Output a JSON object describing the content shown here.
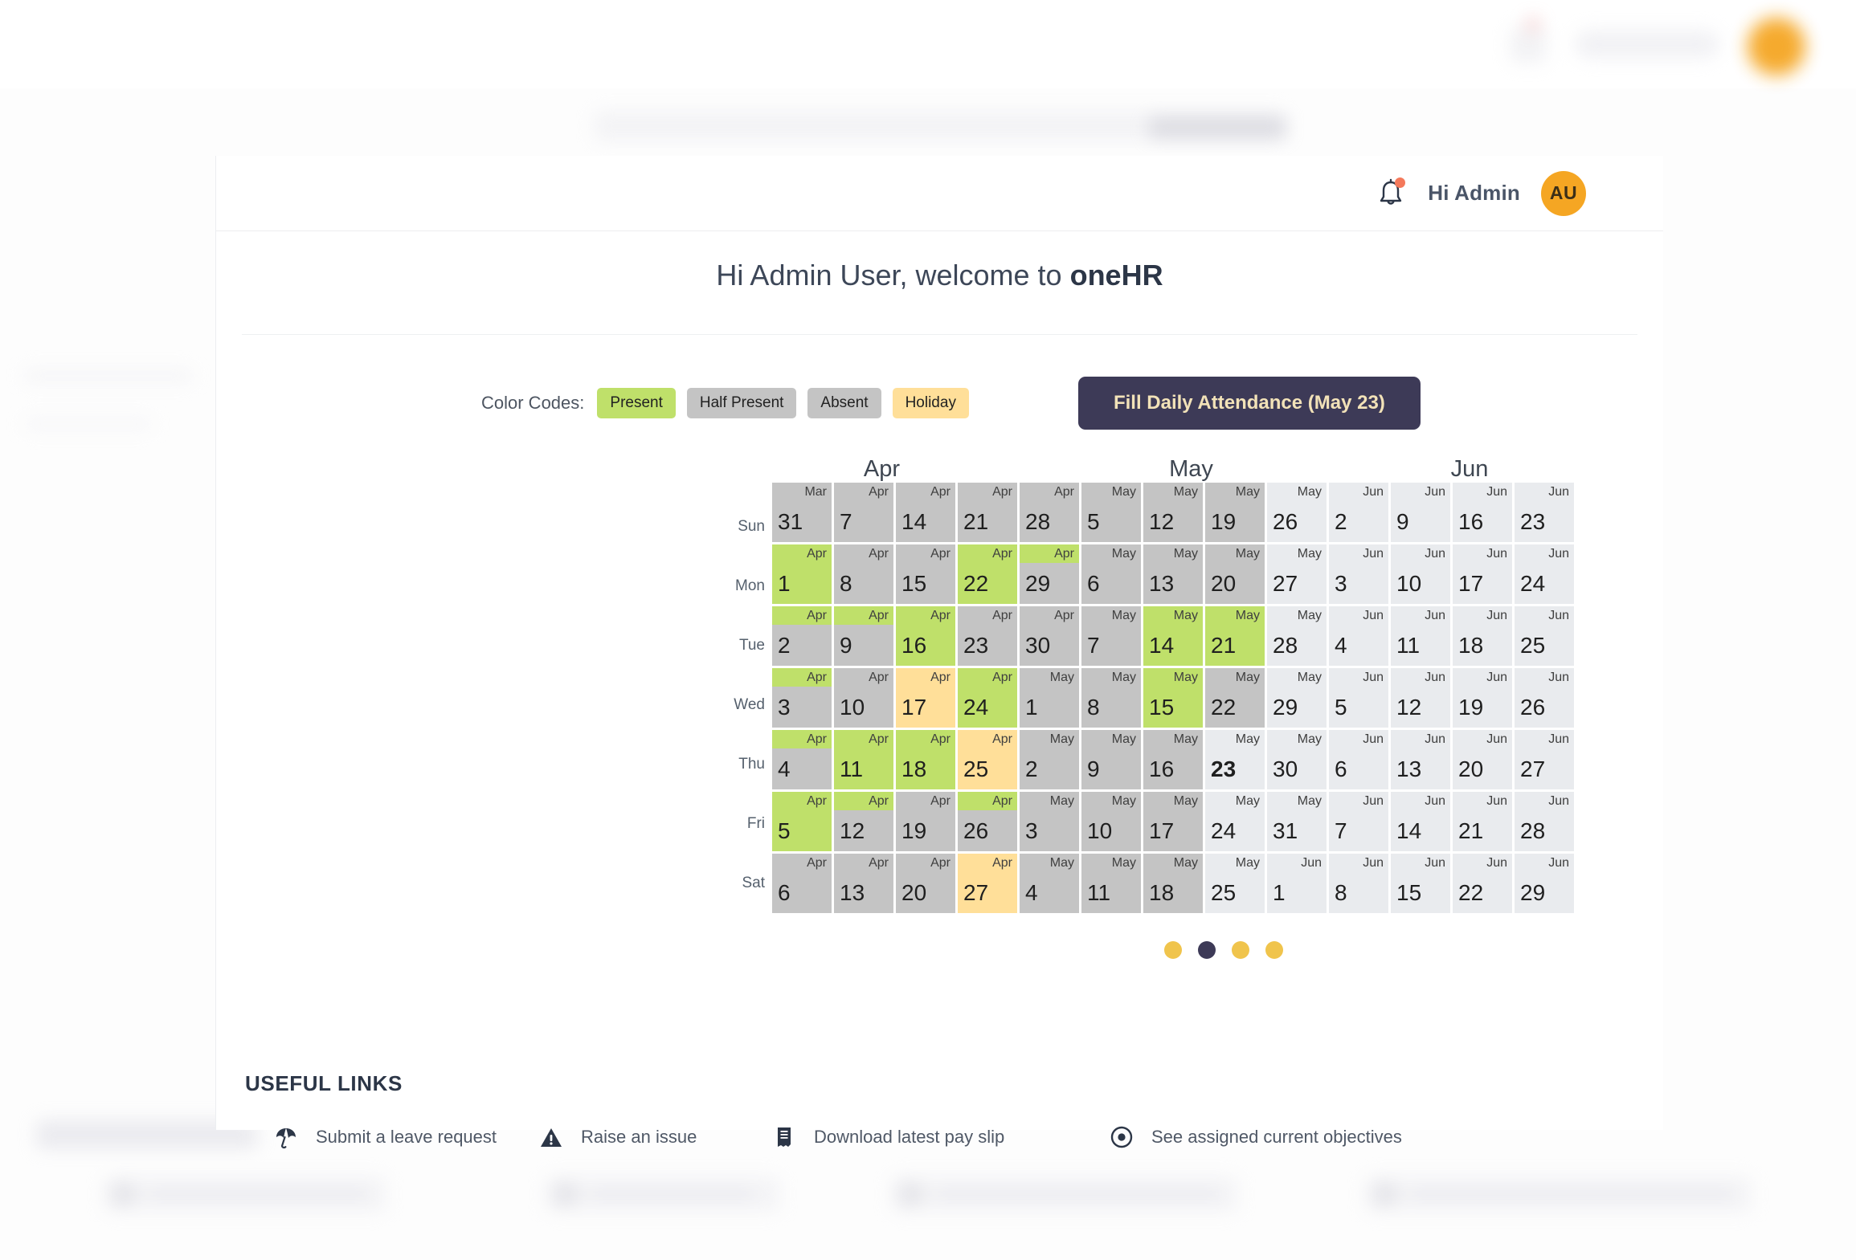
{
  "header": {
    "bell_icon": "bell-icon",
    "has_notification": true,
    "greeting": "Hi Admin",
    "avatar_initials": "AU"
  },
  "welcome": {
    "prefix": "Hi Admin User, welcome to ",
    "brand": "oneHR"
  },
  "legend": {
    "label": "Color Codes:",
    "chips": [
      {
        "label": "Present",
        "color": "#bfe06a"
      },
      {
        "label": "Half Present",
        "color": "#c4c4c4"
      },
      {
        "label": "Absent",
        "color": "#c4c4c4"
      },
      {
        "label": "Holiday",
        "color": "#ffdf99"
      }
    ],
    "fill_button": "Fill Daily Attendance (May 23)"
  },
  "calendar": {
    "month_headers": [
      {
        "label": "Apr",
        "span": 5
      },
      {
        "label": "May",
        "span": 5
      },
      {
        "label": "Jun",
        "span": 4
      }
    ],
    "day_labels": [
      "Sun",
      "Mon",
      "Tue",
      "Wed",
      "Thu",
      "Fri",
      "Sat"
    ],
    "weeks": [
      [
        {
          "mon": "Mar",
          "day": "31",
          "top": "gray",
          "bot": "gray"
        },
        {
          "mon": "Apr",
          "day": "1",
          "top": "green",
          "bot": "green"
        },
        {
          "mon": "Apr",
          "day": "2",
          "top": "green",
          "bot": "gray"
        },
        {
          "mon": "Apr",
          "day": "3",
          "top": "green",
          "bot": "gray"
        },
        {
          "mon": "Apr",
          "day": "4",
          "top": "green",
          "bot": "gray"
        },
        {
          "mon": "Apr",
          "day": "5",
          "top": "green",
          "bot": "green"
        },
        {
          "mon": "Apr",
          "day": "6",
          "top": "gray",
          "bot": "gray"
        }
      ],
      [
        {
          "mon": "Apr",
          "day": "7",
          "top": "gray",
          "bot": "gray"
        },
        {
          "mon": "Apr",
          "day": "8",
          "top": "gray",
          "bot": "gray"
        },
        {
          "mon": "Apr",
          "day": "9",
          "top": "green",
          "bot": "gray"
        },
        {
          "mon": "Apr",
          "day": "10",
          "top": "gray",
          "bot": "gray"
        },
        {
          "mon": "Apr",
          "day": "11",
          "top": "green",
          "bot": "green"
        },
        {
          "mon": "Apr",
          "day": "12",
          "top": "green",
          "bot": "gray"
        },
        {
          "mon": "Apr",
          "day": "13",
          "top": "gray",
          "bot": "gray"
        }
      ],
      [
        {
          "mon": "Apr",
          "day": "14",
          "top": "gray",
          "bot": "gray"
        },
        {
          "mon": "Apr",
          "day": "15",
          "top": "gray",
          "bot": "gray"
        },
        {
          "mon": "Apr",
          "day": "16",
          "top": "green",
          "bot": "green"
        },
        {
          "mon": "Apr",
          "day": "17",
          "top": "yellow",
          "bot": "yellow"
        },
        {
          "mon": "Apr",
          "day": "18",
          "top": "green",
          "bot": "green"
        },
        {
          "mon": "Apr",
          "day": "19",
          "top": "gray",
          "bot": "gray"
        },
        {
          "mon": "Apr",
          "day": "20",
          "top": "gray",
          "bot": "gray"
        }
      ],
      [
        {
          "mon": "Apr",
          "day": "21",
          "top": "gray",
          "bot": "gray"
        },
        {
          "mon": "Apr",
          "day": "22",
          "top": "green",
          "bot": "green"
        },
        {
          "mon": "Apr",
          "day": "23",
          "top": "gray",
          "bot": "gray"
        },
        {
          "mon": "Apr",
          "day": "24",
          "top": "green",
          "bot": "green"
        },
        {
          "mon": "Apr",
          "day": "25",
          "top": "yellow",
          "bot": "yellow"
        },
        {
          "mon": "Apr",
          "day": "26",
          "top": "green",
          "bot": "gray"
        },
        {
          "mon": "Apr",
          "day": "27",
          "top": "yellow",
          "bot": "yellow"
        }
      ],
      [
        {
          "mon": "Apr",
          "day": "28",
          "top": "gray",
          "bot": "gray"
        },
        {
          "mon": "Apr",
          "day": "29",
          "top": "green",
          "bot": "gray"
        },
        {
          "mon": "Apr",
          "day": "30",
          "top": "gray",
          "bot": "gray"
        },
        {
          "mon": "May",
          "day": "1",
          "top": "gray",
          "bot": "gray"
        },
        {
          "mon": "May",
          "day": "2",
          "top": "gray",
          "bot": "gray"
        },
        {
          "mon": "May",
          "day": "3",
          "top": "gray",
          "bot": "gray"
        },
        {
          "mon": "May",
          "day": "4",
          "top": "gray",
          "bot": "gray"
        }
      ],
      [
        {
          "mon": "May",
          "day": "5",
          "top": "gray",
          "bot": "gray"
        },
        {
          "mon": "May",
          "day": "6",
          "top": "gray",
          "bot": "gray"
        },
        {
          "mon": "May",
          "day": "7",
          "top": "gray",
          "bot": "gray"
        },
        {
          "mon": "May",
          "day": "8",
          "top": "gray",
          "bot": "gray"
        },
        {
          "mon": "May",
          "day": "9",
          "top": "gray",
          "bot": "gray"
        },
        {
          "mon": "May",
          "day": "10",
          "top": "gray",
          "bot": "gray"
        },
        {
          "mon": "May",
          "day": "11",
          "top": "gray",
          "bot": "gray"
        }
      ],
      [
        {
          "mon": "May",
          "day": "12",
          "top": "gray",
          "bot": "gray"
        },
        {
          "mon": "May",
          "day": "13",
          "top": "gray",
          "bot": "gray"
        },
        {
          "mon": "May",
          "day": "14",
          "top": "green",
          "bot": "green"
        },
        {
          "mon": "May",
          "day": "15",
          "top": "green",
          "bot": "green"
        },
        {
          "mon": "May",
          "day": "16",
          "top": "gray",
          "bot": "gray"
        },
        {
          "mon": "May",
          "day": "17",
          "top": "gray",
          "bot": "gray"
        },
        {
          "mon": "May",
          "day": "18",
          "top": "gray",
          "bot": "gray"
        }
      ],
      [
        {
          "mon": "May",
          "day": "19",
          "top": "gray",
          "bot": "gray"
        },
        {
          "mon": "May",
          "day": "20",
          "top": "gray",
          "bot": "gray"
        },
        {
          "mon": "May",
          "day": "21",
          "top": "green",
          "bot": "green"
        },
        {
          "mon": "May",
          "day": "22",
          "top": "gray",
          "bot": "gray"
        },
        {
          "mon": "May",
          "day": "23",
          "top": "light",
          "bot": "light",
          "today": true
        },
        {
          "mon": "May",
          "day": "24",
          "top": "light",
          "bot": "light"
        },
        {
          "mon": "May",
          "day": "25",
          "top": "light",
          "bot": "light"
        }
      ],
      [
        {
          "mon": "May",
          "day": "26",
          "top": "light",
          "bot": "light"
        },
        {
          "mon": "May",
          "day": "27",
          "top": "light",
          "bot": "light"
        },
        {
          "mon": "May",
          "day": "28",
          "top": "light",
          "bot": "light"
        },
        {
          "mon": "May",
          "day": "29",
          "top": "light",
          "bot": "light"
        },
        {
          "mon": "May",
          "day": "30",
          "top": "light",
          "bot": "light"
        },
        {
          "mon": "May",
          "day": "31",
          "top": "light",
          "bot": "light"
        },
        {
          "mon": "Jun",
          "day": "1",
          "top": "light",
          "bot": "light"
        }
      ],
      [
        {
          "mon": "Jun",
          "day": "2",
          "top": "light",
          "bot": "light"
        },
        {
          "mon": "Jun",
          "day": "3",
          "top": "light",
          "bot": "light"
        },
        {
          "mon": "Jun",
          "day": "4",
          "top": "light",
          "bot": "light"
        },
        {
          "mon": "Jun",
          "day": "5",
          "top": "light",
          "bot": "light"
        },
        {
          "mon": "Jun",
          "day": "6",
          "top": "light",
          "bot": "light"
        },
        {
          "mon": "Jun",
          "day": "7",
          "top": "light",
          "bot": "light"
        },
        {
          "mon": "Jun",
          "day": "8",
          "top": "light",
          "bot": "light"
        }
      ],
      [
        {
          "mon": "Jun",
          "day": "9",
          "top": "light",
          "bot": "light"
        },
        {
          "mon": "Jun",
          "day": "10",
          "top": "light",
          "bot": "light"
        },
        {
          "mon": "Jun",
          "day": "11",
          "top": "light",
          "bot": "light"
        },
        {
          "mon": "Jun",
          "day": "12",
          "top": "light",
          "bot": "light"
        },
        {
          "mon": "Jun",
          "day": "13",
          "top": "light",
          "bot": "light"
        },
        {
          "mon": "Jun",
          "day": "14",
          "top": "light",
          "bot": "light"
        },
        {
          "mon": "Jun",
          "day": "15",
          "top": "light",
          "bot": "light"
        }
      ],
      [
        {
          "mon": "Jun",
          "day": "16",
          "top": "light",
          "bot": "light"
        },
        {
          "mon": "Jun",
          "day": "17",
          "top": "light",
          "bot": "light"
        },
        {
          "mon": "Jun",
          "day": "18",
          "top": "light",
          "bot": "light"
        },
        {
          "mon": "Jun",
          "day": "19",
          "top": "light",
          "bot": "light"
        },
        {
          "mon": "Jun",
          "day": "20",
          "top": "light",
          "bot": "light"
        },
        {
          "mon": "Jun",
          "day": "21",
          "top": "light",
          "bot": "light"
        },
        {
          "mon": "Jun",
          "day": "22",
          "top": "light",
          "bot": "light"
        }
      ],
      [
        {
          "mon": "Jun",
          "day": "23",
          "top": "light",
          "bot": "light"
        },
        {
          "mon": "Jun",
          "day": "24",
          "top": "light",
          "bot": "light"
        },
        {
          "mon": "Jun",
          "day": "25",
          "top": "light",
          "bot": "light"
        },
        {
          "mon": "Jun",
          "day": "26",
          "top": "light",
          "bot": "light"
        },
        {
          "mon": "Jun",
          "day": "27",
          "top": "light",
          "bot": "light"
        },
        {
          "mon": "Jun",
          "day": "28",
          "top": "light",
          "bot": "light"
        },
        {
          "mon": "Jun",
          "day": "29",
          "top": "light",
          "bot": "light"
        }
      ]
    ]
  },
  "carousel": {
    "dots": 4,
    "active_index": 1,
    "active_color": "#3d3a57",
    "inactive_color": "#f0c44c"
  },
  "useful_links": {
    "title": "USEFUL LINKS",
    "items": [
      {
        "icon": "beach-umbrella-icon",
        "label": "Submit a leave request"
      },
      {
        "icon": "warning-triangle-icon",
        "label": "Raise an issue"
      },
      {
        "icon": "receipt-icon",
        "label": "Download latest pay slip"
      },
      {
        "icon": "target-icon",
        "label": "See assigned current objectives"
      }
    ]
  }
}
